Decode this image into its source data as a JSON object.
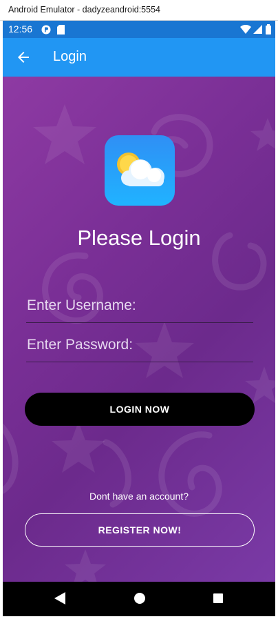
{
  "window": {
    "title": "Android Emulator - dadyzeandroid:5554"
  },
  "status_bar": {
    "time": "12:56"
  },
  "app_bar": {
    "title": "Login"
  },
  "main": {
    "heading": "Please Login",
    "username_placeholder": "Enter Username:",
    "password_placeholder": "Enter Password:",
    "login_button": "LOGIN NOW",
    "no_account_text": "Dont have an account?",
    "register_button": "REGISTER NOW!"
  },
  "colors": {
    "app_bar": "#2196f3",
    "status_bar": "#1976d2",
    "background_gradient_start": "#8e3aa3",
    "background_gradient_end": "#6c2a8c",
    "login_button": "#000000"
  }
}
